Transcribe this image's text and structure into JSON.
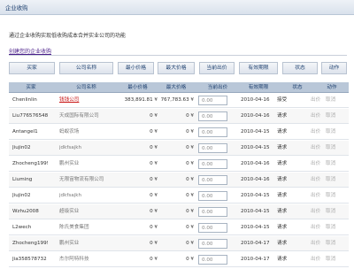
{
  "header": {
    "title": "企业收购"
  },
  "intro": {
    "text": "通过企业收购实现低收购成本合并实业公司的功能"
  },
  "create_link": {
    "label": "创建您的企业收购"
  },
  "buttons": [
    {
      "label": "买家"
    },
    {
      "label": "公司名称"
    },
    {
      "label": "最小价格"
    },
    {
      "label": "最大价格"
    },
    {
      "label": "当前出价"
    },
    {
      "label": "有效期限"
    },
    {
      "label": "状态"
    },
    {
      "label": "动作"
    }
  ],
  "table": {
    "columns": [
      "买家",
      "公司名称",
      "最小价格",
      "最大价格",
      "当前出价",
      "有效期限",
      "状态",
      "动作"
    ],
    "bid_placeholder": "0.00",
    "rows": [
      {
        "buyer": "Chenlinlin",
        "company": "钱钱公司",
        "min": "383,891.81 ¥",
        "max": "767,783.63 ¥",
        "bid": "0.00",
        "date": "2010-04-16",
        "status": "接受",
        "act1": "出价",
        "act2": "取消",
        "highlight": true
      },
      {
        "buyer": "Liu776576548",
        "company": "天成国际有限公司",
        "min": "0 ¥",
        "max": "0 ¥",
        "bid": "0.00",
        "date": "2010-04-16",
        "status": "请求",
        "act1": "出价",
        "act2": "取消",
        "highlight": false
      },
      {
        "buyer": "Antangel1",
        "company": "蚂蚁农场",
        "min": "0 ¥",
        "max": "0 ¥",
        "bid": "0.00",
        "date": "2010-04-15",
        "status": "请求",
        "act1": "出价",
        "act2": "取消",
        "highlight": false
      },
      {
        "buyer": "Jiujin02",
        "company": "jdkfsajkh",
        "min": "0 ¥",
        "max": "0 ¥",
        "bid": "0.00",
        "date": "2010-04-15",
        "status": "请求",
        "act1": "出价",
        "act2": "取消",
        "highlight": false
      },
      {
        "buyer": "Zhocheng1999",
        "company": "鹏州实业",
        "min": "0 ¥",
        "max": "0 ¥",
        "bid": "0.00",
        "date": "2010-04-16",
        "status": "请求",
        "act1": "出价",
        "act2": "取消",
        "highlight": false
      },
      {
        "buyer": "Liuming",
        "company": "无限宙物流有限公司",
        "min": "0 ¥",
        "max": "0 ¥",
        "bid": "0.00",
        "date": "2010-04-16",
        "status": "请求",
        "act1": "出价",
        "act2": "取消",
        "highlight": false
      },
      {
        "buyer": "Jiujin02",
        "company": "jdkfsajkh",
        "min": "0 ¥",
        "max": "0 ¥",
        "bid": "0.00",
        "date": "2010-04-15",
        "status": "请求",
        "act1": "出价",
        "act2": "取消",
        "highlight": false
      },
      {
        "buyer": "Wzhu2008",
        "company": "超级实业",
        "min": "0 ¥",
        "max": "0 ¥",
        "bid": "0.00",
        "date": "2010-04-15",
        "status": "请求",
        "act1": "出价",
        "act2": "取消",
        "highlight": false
      },
      {
        "buyer": "L2wech",
        "company": "陈氏美食集团",
        "min": "0 ¥",
        "max": "0 ¥",
        "bid": "0.00",
        "date": "2010-04-15",
        "status": "请求",
        "act1": "出价",
        "act2": "取消",
        "highlight": false
      },
      {
        "buyer": "Zhocheng1999",
        "company": "鹏州实业",
        "min": "0 ¥",
        "max": "0 ¥",
        "bid": "0.00",
        "date": "2010-04-17",
        "status": "请求",
        "act1": "出价",
        "act2": "取消",
        "highlight": false
      },
      {
        "buyer": "Jia358578732",
        "company": "杰尔阿特科技",
        "min": "0 ¥",
        "max": "0 ¥",
        "bid": "0.00",
        "date": "2010-04-17",
        "status": "请求",
        "act1": "出价",
        "act2": "取消",
        "highlight": false
      }
    ]
  },
  "colors": {
    "header_bg": "#b9c7d8",
    "title_text": "#1d3f6e",
    "highlight_link": "#c81414",
    "create_link": "#4a1f8a"
  }
}
